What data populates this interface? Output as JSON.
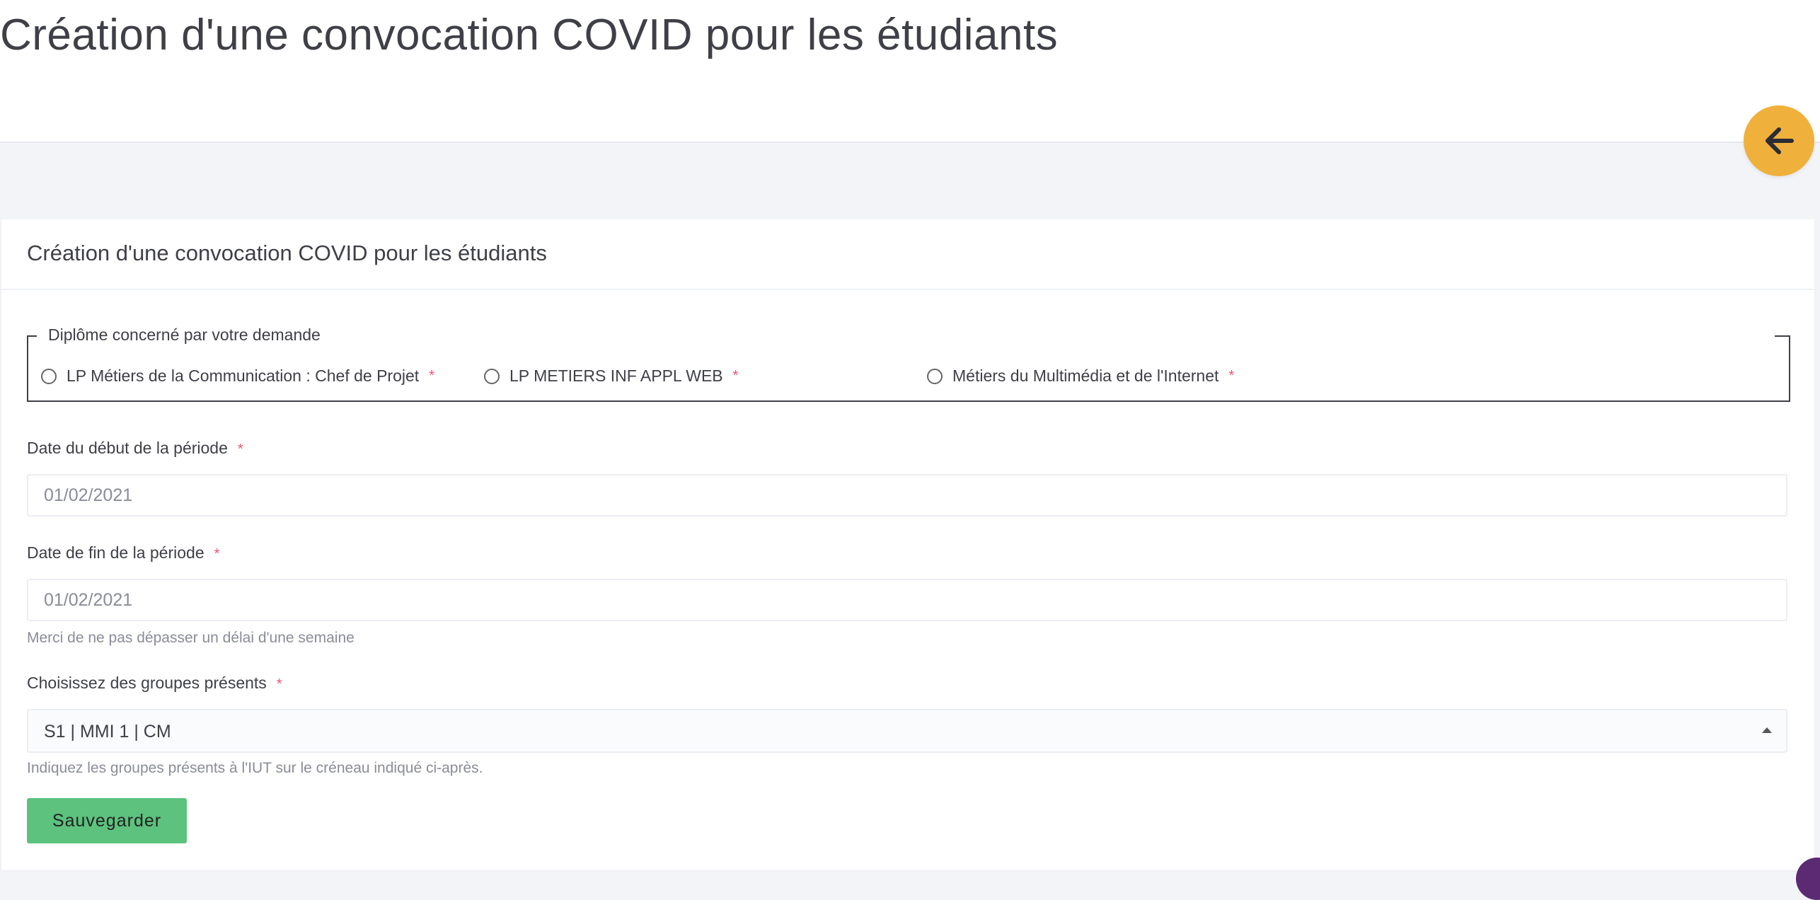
{
  "page": {
    "title": "Création d'une convocation COVID pour les étudiants"
  },
  "card": {
    "title": "Création d'une convocation COVID pour les étudiants"
  },
  "diploma": {
    "legend": "Diplôme concerné par votre demande",
    "options": [
      {
        "label": "LP Métiers de la Communication : Chef de Projet",
        "required": "*"
      },
      {
        "label": "LP METIERS INF APPL WEB",
        "required": "*"
      },
      {
        "label": "Métiers du Multimédia et de l'Internet",
        "required": "*"
      }
    ]
  },
  "start_date": {
    "label": "Date du début de la période",
    "required": "*",
    "value": "01/02/2021"
  },
  "end_date": {
    "label": "Date de fin de la période",
    "required": "*",
    "value": "01/02/2021",
    "help": "Merci de ne pas dépasser un délai d'une semaine"
  },
  "groups": {
    "label": "Choisissez des groupes présents",
    "required": "*",
    "selected": "S1 | MMI 1 | CM",
    "help": "Indiquez les groupes présents à l'IUT sur le créneau indiqué ci-après."
  },
  "actions": {
    "save_label": "Sauvegarder"
  },
  "colors": {
    "accent": "#f0b03c",
    "save": "#5cc27e",
    "required": "#f4516c"
  },
  "icons": {
    "back": "arrow-left-icon"
  }
}
